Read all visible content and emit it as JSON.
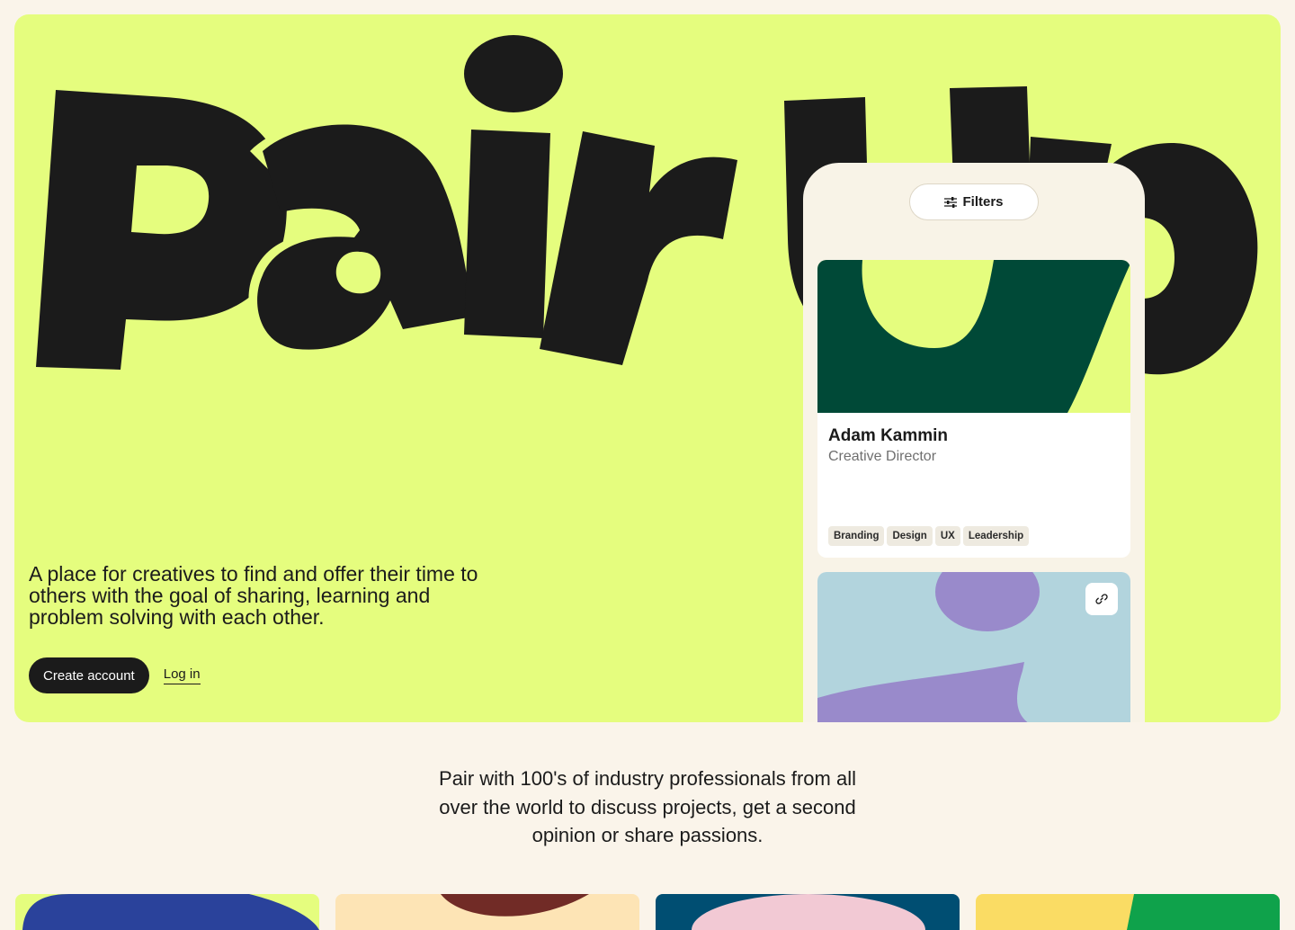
{
  "hero": {
    "wordmark_text": "Pair Up",
    "tagline": "A place for creatives to find and offer their time to others with the goal of sharing, learning and problem solving with each other.",
    "primary_cta": "Create account",
    "secondary_cta": "Log in",
    "colors": {
      "background": "#e5fd7e",
      "ink": "#1b1b1b"
    }
  },
  "phone": {
    "filters_label": "Filters",
    "filters_icon": "sliders-icon",
    "profile_card": {
      "name": "Adam Kammin",
      "role": "Creative Director",
      "tags": [
        "Branding",
        "Design",
        "UX",
        "Leadership"
      ],
      "art_colors": {
        "primary": "#004937",
        "accent": "#e5fd7e"
      }
    },
    "second_card": {
      "link_icon": "link-icon",
      "art_colors": {
        "background": "#b2d4dd",
        "accent": "#998acb"
      }
    }
  },
  "section": {
    "copy": "Pair with 100's of industry professionals from all over the world to discuss projects, get a second opinion or share passions."
  },
  "thumbnails": [
    {
      "bg": "#e5fd7e",
      "accent": "#2a429b"
    },
    {
      "bg": "#fde4b5",
      "accent": "#712b26"
    },
    {
      "bg": "#004e72",
      "accent": "#f2c9d4"
    },
    {
      "bg": "#fadc64",
      "accent": "#0fa24b"
    }
  ]
}
